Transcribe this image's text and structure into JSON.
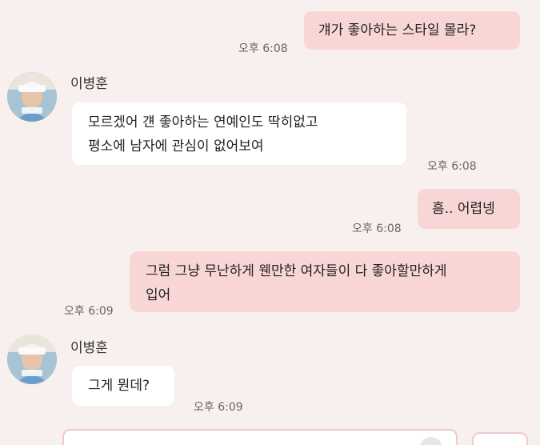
{
  "messages": [
    {
      "text": "걔가 좋아하는 스타일 몰라?",
      "time": "오후 6:08"
    },
    {
      "sender": "이병훈",
      "text": "모르겠어 걘 좋아하는 연예인도 딱히없고\n평소에 남자에 관심이 없어보여",
      "time": "오후 6:08"
    },
    {
      "text": "흠.. 어렵넹",
      "time": "오후 6:08"
    },
    {
      "text": "그럼 그냥 무난하게 웬만한 여자들이 다 좋아할만하게\n입어",
      "time": "오후 6:09"
    },
    {
      "sender": "이병훈",
      "text": "그게 뭔데?",
      "time": "오후 6:09"
    }
  ],
  "avatar_icon": "profile-photo",
  "colors": {
    "background": "#f8efef",
    "my_bubble": "#f8d6d6",
    "their_bubble": "#ffffff",
    "input_border": "#f2c9c9"
  }
}
